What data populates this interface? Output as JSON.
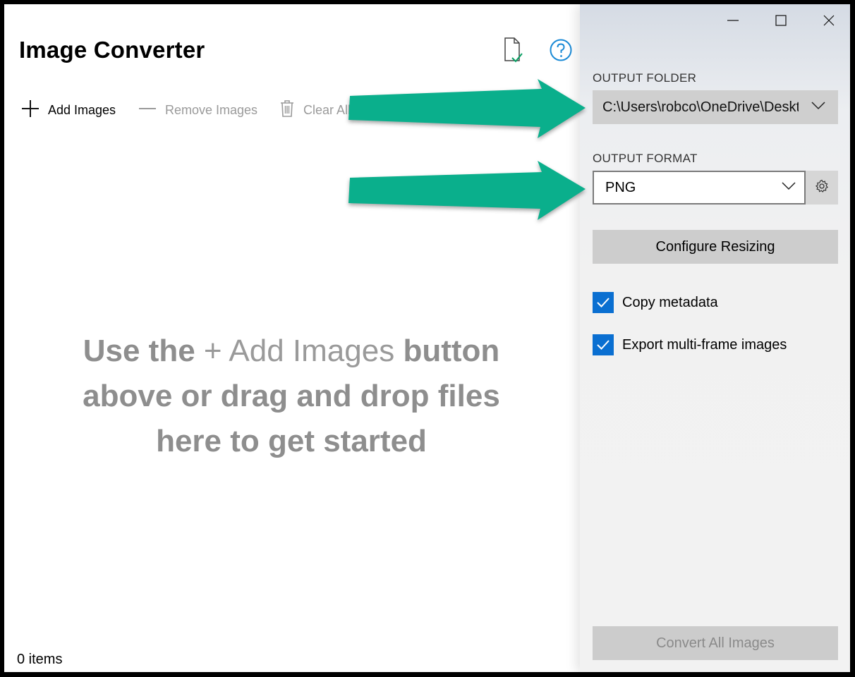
{
  "app": {
    "title": "Image Converter"
  },
  "toolbar": {
    "add_label": "Add Images",
    "remove_label": "Remove Images",
    "clear_label": "Clear All"
  },
  "empty_state": {
    "part1_bold": "Use the",
    "part2_light": "+ Add Images",
    "part3_bold": "button",
    "line2": "above or drag and drop files",
    "line3": "here to get started"
  },
  "status": {
    "items": "0 items"
  },
  "settings": {
    "output_folder_label": "OUTPUT FOLDER",
    "output_folder_value": "C:\\Users\\robco\\OneDrive\\Desktop",
    "output_format_label": "OUTPUT FORMAT",
    "output_format_value": "PNG",
    "resize_label": "Configure Resizing",
    "copy_metadata_label": "Copy metadata",
    "copy_metadata_checked": true,
    "export_frames_label": "Export multi-frame images",
    "export_frames_checked": true,
    "convert_label": "Convert All Images"
  },
  "colors": {
    "accent": "#0a6fd1",
    "annotation_arrow": "#0aaf8c",
    "help_icon": "#1a8ad6"
  },
  "icons": [
    "file-check-icon",
    "help-icon",
    "plus-icon",
    "minus-icon",
    "trash-icon",
    "chevron-down-icon",
    "gear-icon",
    "checkmark-icon",
    "minimize-icon",
    "maximize-icon",
    "close-icon"
  ]
}
